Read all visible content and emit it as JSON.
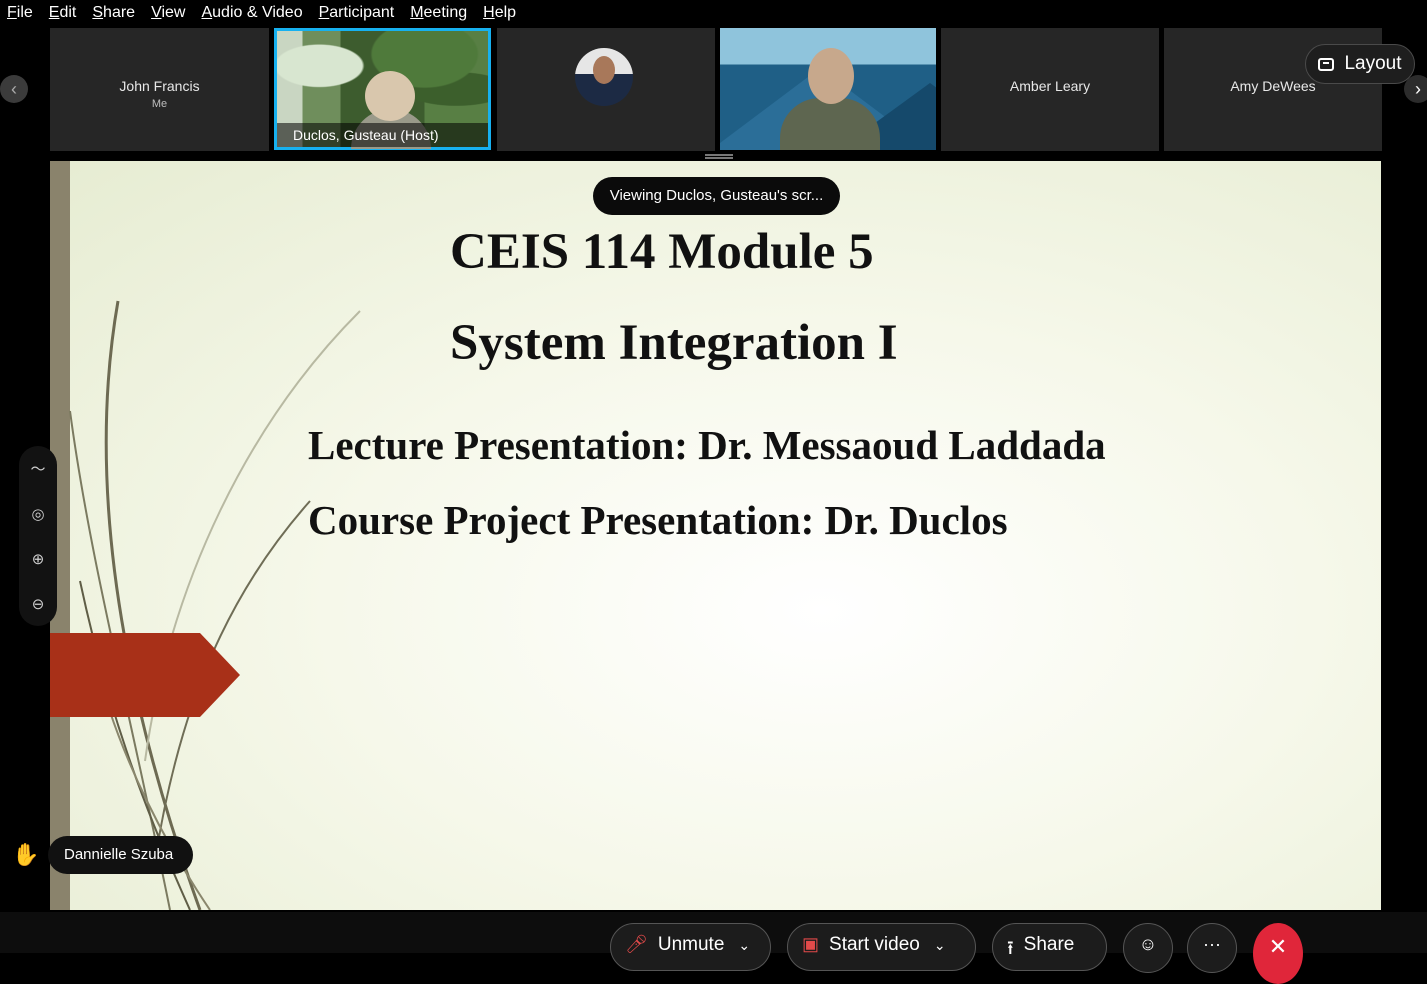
{
  "menu": [
    {
      "label": "File",
      "accel": "F",
      "rest": "ile"
    },
    {
      "label": "Edit",
      "accel": "E",
      "rest": "dit"
    },
    {
      "label": "Share",
      "accel": "S",
      "rest": "hare"
    },
    {
      "label": "View",
      "accel": "V",
      "rest": "iew"
    },
    {
      "label": "Audio & Video",
      "accel": "A",
      "rest": "udio & Video"
    },
    {
      "label": "Participant",
      "accel": "P",
      "rest": "articipant"
    },
    {
      "label": "Meeting",
      "accel": "M",
      "rest": "eeting"
    },
    {
      "label": "Help",
      "accel": "H",
      "rest": "elp"
    }
  ],
  "participants": {
    "john": {
      "name": "John Francis",
      "sub": "Me"
    },
    "host": {
      "label": "Duclos, Gusteau  (Host)"
    },
    "amber": {
      "name": "Amber Leary"
    },
    "amy": {
      "name": "Amy DeWees"
    }
  },
  "layout_button": {
    "label": "Layout"
  },
  "viewing": "Viewing Duclos, Gusteau's scr...",
  "slide": {
    "line1": "CEIS 114 Module 5",
    "line2": "System Integration I",
    "line3": "Lecture Presentation:  Dr. Messaoud Laddada",
    "line4": "Course Project Presentation: Dr. Duclos"
  },
  "reaction": {
    "name": "Dannielle Szuba"
  },
  "controls": {
    "unmute": "Unmute",
    "start_video": "Start video",
    "share": "Share",
    "more": "···"
  },
  "icons": {
    "nav_left": "chevron-left-icon",
    "nav_right": "chevron-right-icon",
    "end": "close-icon"
  },
  "colors": {
    "active_speaker_border": "#17b1f0",
    "end_button": "#e0263a",
    "slide_accent": "#a83018"
  }
}
